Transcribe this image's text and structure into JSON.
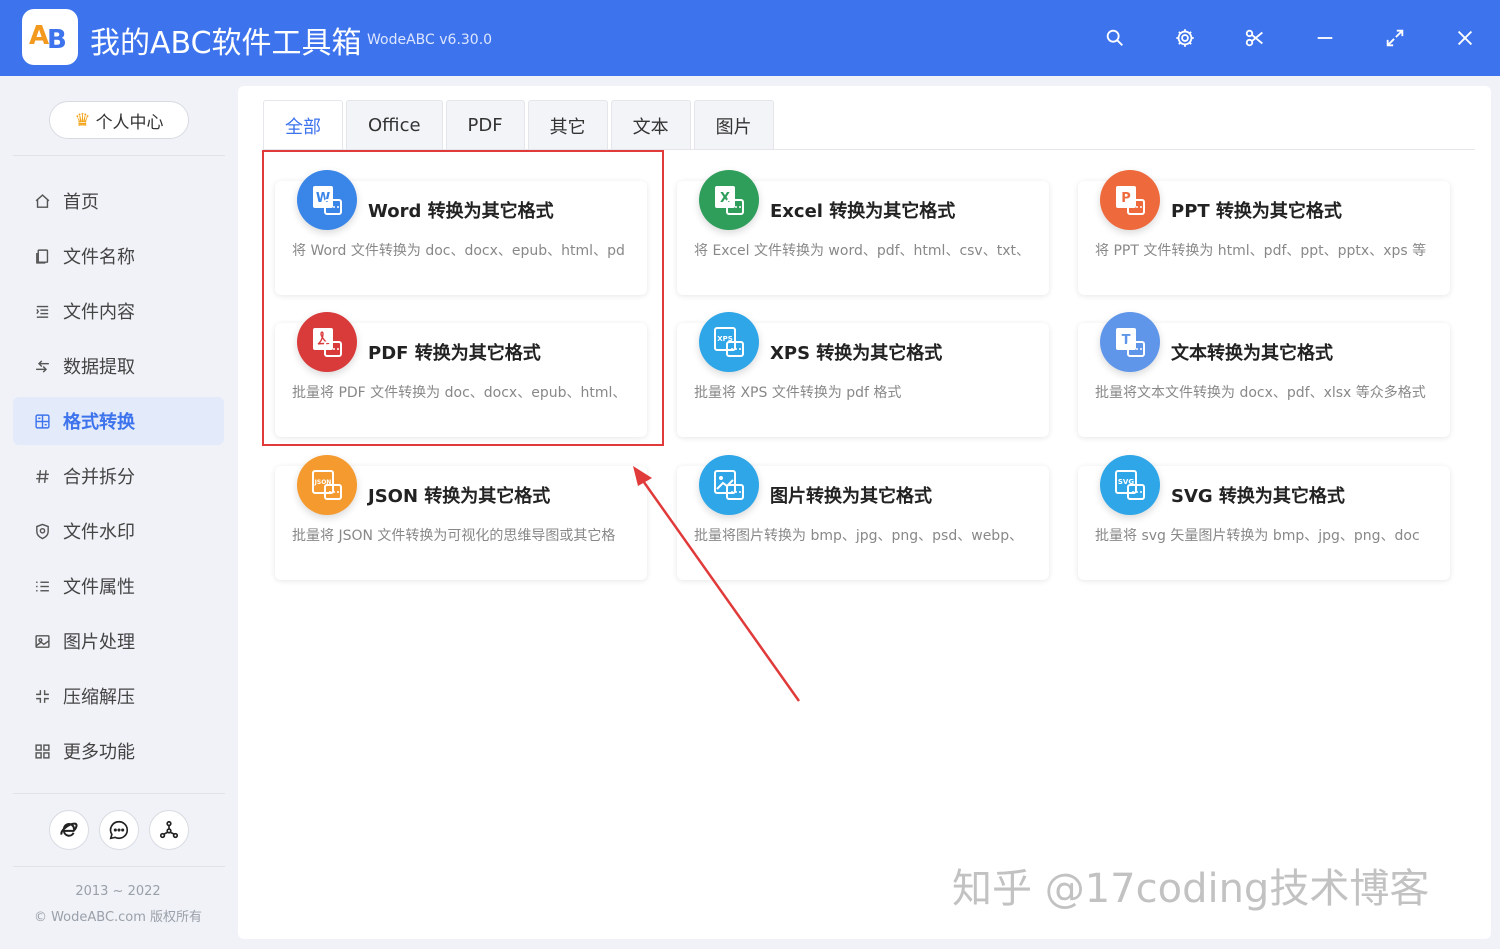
{
  "app": {
    "title": "我的ABC软件工具箱",
    "version": "WodeABC v6.30.0",
    "accent_color": "#3d73ed"
  },
  "titlebar_buttons": [
    {
      "name": "search-icon"
    },
    {
      "name": "gear-icon"
    },
    {
      "name": "scissors-icon"
    },
    {
      "name": "minimize-icon"
    },
    {
      "name": "maximize-icon"
    },
    {
      "name": "close-icon"
    }
  ],
  "sidebar": {
    "user_center": "个人中心",
    "items": [
      {
        "label": "首页",
        "icon": "home-icon"
      },
      {
        "label": "文件名称",
        "icon": "file-name-icon"
      },
      {
        "label": "文件内容",
        "icon": "file-content-icon"
      },
      {
        "label": "数据提取",
        "icon": "data-extract-icon"
      },
      {
        "label": "格式转换",
        "icon": "format-convert-icon",
        "active": true
      },
      {
        "label": "合并拆分",
        "icon": "hash-icon"
      },
      {
        "label": "文件水印",
        "icon": "shield-icon"
      },
      {
        "label": "文件属性",
        "icon": "list-icon"
      },
      {
        "label": "图片处理",
        "icon": "image-icon"
      },
      {
        "label": "压缩解压",
        "icon": "compress-icon"
      },
      {
        "label": "更多功能",
        "icon": "grid-icon"
      }
    ],
    "footer": {
      "years": "2013 ~ 2022",
      "copyright": "© WodeABC.com 版权所有"
    }
  },
  "tabs": [
    "全部",
    "Office",
    "PDF",
    "其它",
    "文本",
    "图片"
  ],
  "cards": [
    {
      "title": "Word 转换为其它格式",
      "desc": "将 Word 文件转换为 doc、docx、epub、html、pd",
      "icon_color": "#3a86e8",
      "glyph": "W"
    },
    {
      "title": "Excel 转换为其它格式",
      "desc": "将 Excel 文件转换为 word、pdf、html、csv、txt、",
      "icon_color": "#2f9e5b",
      "glyph": "X"
    },
    {
      "title": "PPT 转换为其它格式",
      "desc": "将 PPT 文件转换为 html、pdf、ppt、pptx、xps 等",
      "icon_color": "#ee6a3c",
      "glyph": "P"
    },
    {
      "title": "PDF 转换为其它格式",
      "desc": "批量将 PDF 文件转换为 doc、docx、epub、html、",
      "icon_color": "#d93a3a",
      "glyph": "pdf"
    },
    {
      "title": "XPS 转换为其它格式",
      "desc": "批量将 XPS 文件转换为 pdf 格式",
      "icon_color": "#2ea6e8",
      "glyph": "XPS"
    },
    {
      "title": "文本转换为其它格式",
      "desc": "批量将文本文件转换为 docx、pdf、xlsx 等众多格式",
      "icon_color": "#5f96ea",
      "glyph": "T"
    },
    {
      "title": "JSON 转换为其它格式",
      "desc": "批量将 JSON 文件转换为可视化的思维导图或其它格",
      "icon_color": "#f59a2e",
      "glyph": "JSON"
    },
    {
      "title": "图片转换为其它格式",
      "desc": "批量将图片转换为 bmp、jpg、png、psd、webp、",
      "icon_color": "#2ea6e8",
      "glyph": "img"
    },
    {
      "title": "SVG 转换为其它格式",
      "desc": "批量将 svg 矢量图片转换为 bmp、jpg、png、doc",
      "icon_color": "#2ea6e8",
      "glyph": "SVG"
    }
  ],
  "watermark": "知乎 @17coding技术博客"
}
